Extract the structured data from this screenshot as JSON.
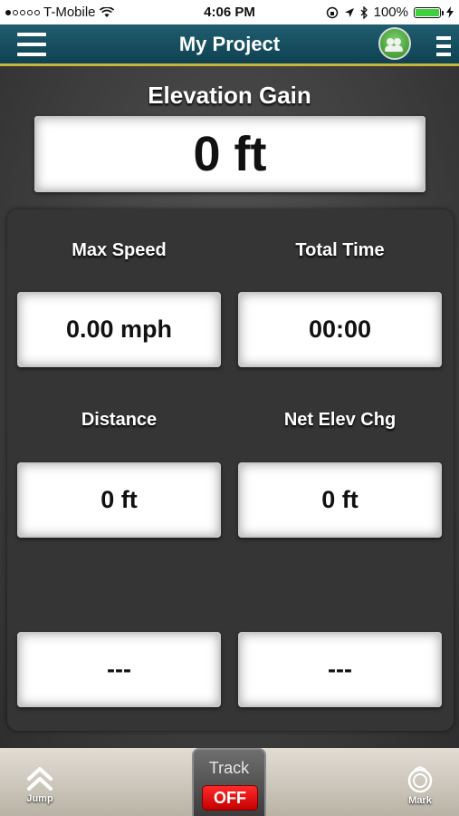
{
  "status_bar": {
    "carrier": "T-Mobile",
    "time": "4:06 PM",
    "battery": "100%",
    "battery_level": 1.0,
    "signal_bars_filled": 1,
    "signal_bars_total": 5
  },
  "header": {
    "title": "My Project"
  },
  "elevation": {
    "label": "Elevation Gain",
    "value": "0 ft"
  },
  "stats": {
    "max_speed_label": "Max Speed",
    "max_speed_value": "0.00 mph",
    "total_time_label": "Total Time",
    "total_time_value": "00:00",
    "distance_label": "Distance",
    "distance_value": "0 ft",
    "net_elev_label": "Net Elev Chg",
    "net_elev_value": "0 ft",
    "extra_1_value": "---",
    "extra_2_value": "---"
  },
  "bottom_bar": {
    "jump_label": "Jump",
    "track_label": "Track",
    "track_state": "OFF",
    "mark_label": "Mark"
  },
  "colors": {
    "header_bg": "#1f5d6f",
    "header_accent": "#c9b43d",
    "off_red": "#e00000",
    "avatar_green": "#3fa02f"
  }
}
